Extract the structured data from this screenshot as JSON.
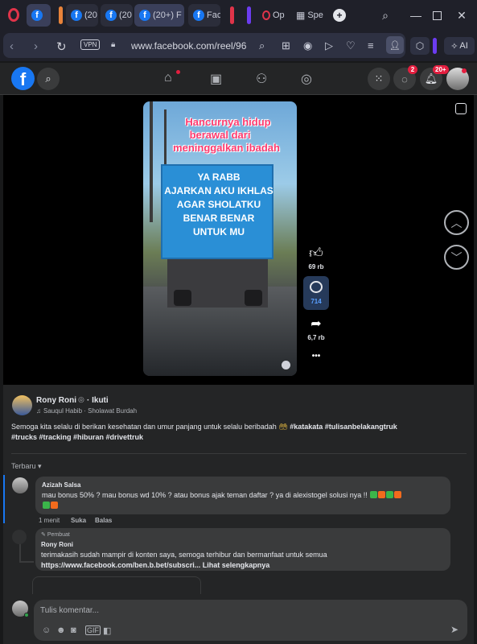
{
  "browser": {
    "tabs": [
      {
        "label": ""
      },
      {
        "label": "(20"
      },
      {
        "label": "(20"
      },
      {
        "label": "(20+) F"
      },
      {
        "label": "Fac"
      },
      {
        "label": "Op"
      },
      {
        "label": "Spe"
      }
    ],
    "vpn_label": "VPN",
    "url": "www.facebook.com/reel/96",
    "ai_label": "AI",
    "colors": {
      "accent": "#1877f2",
      "tab_orange": "#e8833a",
      "tab_red": "#e0344a",
      "tab_purple": "#6c3cf0"
    }
  },
  "fb_header": {
    "messenger_badge": "2",
    "notif_badge": "20+"
  },
  "reel": {
    "overlay_text": [
      "Hancurnya hidup",
      "berawal dari",
      "meninggalkan ibadah"
    ],
    "truck_text": [
      "YA RABB",
      "AJARKAN AKU IKHLAS",
      "AGAR SHOLATKU",
      "BENAR BENAR",
      "UNTUK MU"
    ],
    "likes": "69 rb",
    "comments": "714",
    "shares": "6,7 rb",
    "more": "•••"
  },
  "post": {
    "author": "Rony Roni",
    "follow": "· Ikuti",
    "music": "Sauqul Habib · Sholawat Burdah",
    "caption_line1": "Semoga kita selalu di berikan kesehatan dan umur panjang untuk selalu beribadah",
    "caption_tags1": "#katakata #tulisanbelakangtruk",
    "caption_line2": "#trucks #tracking #hiburan #drivettruk",
    "sort_label": "Terbaru"
  },
  "comments": [
    {
      "name": "Azizah Salsa",
      "text_line1": "mau bonus 50% ? mau bonus wd 10% ? atau bonus ajak teman daftar ? ya di alexistogel solusi nya !!",
      "time": "1 menit",
      "like": "Suka",
      "reply": "Balas"
    },
    {
      "creator_tag": "Pembuat",
      "name": "Rony Roni",
      "text_line1": "terimakasih sudah mampir di konten saya, semoga terhibur dan bermanfaat untuk semua",
      "link": "https://www.facebook.com/ben.b.bet/subscri...",
      "see_more": "Lihat selengkapnya"
    }
  ],
  "composer": {
    "placeholder": "Tulis komentar..."
  }
}
